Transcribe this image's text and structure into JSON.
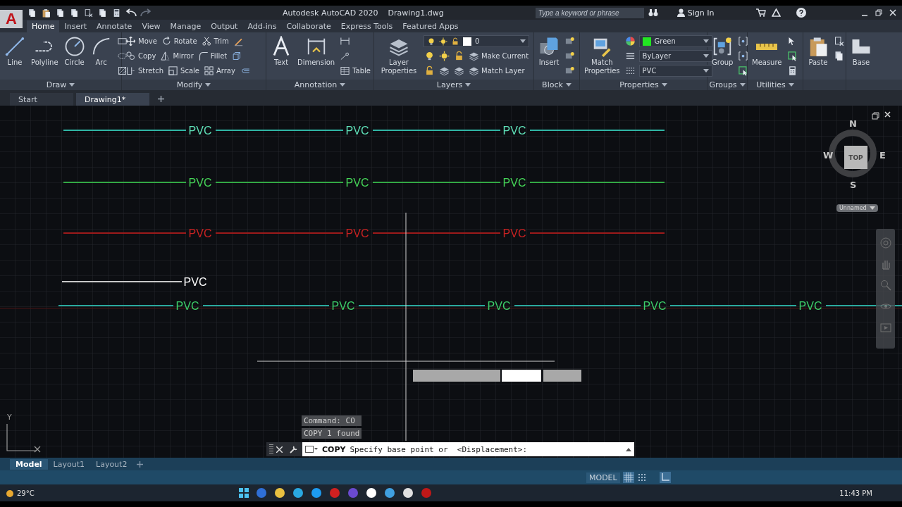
{
  "title_bar": {
    "app_button": "A",
    "title": "Autodesk AutoCAD 2020",
    "file": "Drawing1.dwg",
    "search": {
      "placeholder": "Type a keyword or phrase"
    },
    "sign_in": "Sign In"
  },
  "ribbon_tabs": [
    {
      "label": "Home",
      "selected": true
    },
    {
      "label": "Insert",
      "selected": false
    },
    {
      "label": "Annotate",
      "selected": false
    },
    {
      "label": "View",
      "selected": false
    },
    {
      "label": "Manage",
      "selected": false
    },
    {
      "label": "Output",
      "selected": false
    },
    {
      "label": "Add-ins",
      "selected": false
    },
    {
      "label": "Collaborate",
      "selected": false
    },
    {
      "label": "Express Tools",
      "selected": false
    },
    {
      "label": "Featured Apps",
      "selected": false
    }
  ],
  "ribbon_panels": [
    {
      "title": "Draw",
      "large": [
        "Line",
        "Polyline",
        "Circle",
        "Arc"
      ],
      "rows": [
        [
          {
            "kind": "icon"
          }
        ],
        [
          {
            "kind": "icon"
          }
        ],
        [
          {
            "kind": "icon"
          }
        ]
      ]
    },
    {
      "title": "Modify",
      "rows": [
        [
          {
            "kind": "tool",
            "label": "Move"
          },
          {
            "kind": "tool",
            "label": "Rotate"
          },
          {
            "kind": "tool",
            "label": "Trim"
          },
          {
            "kind": "icon"
          }
        ],
        [
          {
            "kind": "tool",
            "label": "Copy"
          },
          {
            "kind": "tool",
            "label": "Mirror"
          },
          {
            "kind": "tool",
            "label": "Fillet"
          },
          {
            "kind": "icon"
          }
        ],
        [
          {
            "kind": "tool",
            "label": "Stretch"
          },
          {
            "kind": "tool",
            "label": "Scale"
          },
          {
            "kind": "tool",
            "label": "Array"
          },
          {
            "kind": "icon"
          }
        ]
      ]
    },
    {
      "title": "Annotation",
      "large": [
        "Text",
        "Dimension"
      ],
      "rows": [
        [
          {
            "kind": "icon"
          }
        ],
        [
          {
            "kind": "icon"
          }
        ],
        [
          {
            "kind": "tool",
            "label": "Table"
          }
        ]
      ]
    },
    {
      "title": "Layers",
      "large": [
        "Layer Properties"
      ],
      "rows": [
        [
          {
            "kind": "dropdown",
            "label": "0"
          }
        ],
        [
          {
            "kind": "icon"
          },
          {
            "kind": "icon"
          },
          {
            "kind": "icon"
          },
          {
            "kind": "tool",
            "label": "Make Current"
          }
        ],
        [
          {
            "kind": "icon"
          },
          {
            "kind": "icon"
          },
          {
            "kind": "icon"
          },
          {
            "kind": "tool",
            "label": "Match Layer"
          }
        ]
      ]
    },
    {
      "title": "Block",
      "large": [
        "Insert"
      ],
      "rows": [
        [
          {
            "kind": "icon"
          }
        ],
        [
          {
            "kind": "icon"
          }
        ],
        [
          {
            "kind": "icon"
          }
        ]
      ]
    },
    {
      "title": "Properties",
      "large": [
        "Match Properties"
      ],
      "rows": [
        [
          {
            "kind": "icon"
          },
          {
            "kind": "color-dropdown",
            "label": "Green",
            "color": "#22e622"
          }
        ],
        [
          {
            "kind": "icon"
          },
          {
            "kind": "dropdown",
            "label": "ByLayer"
          }
        ],
        [
          {
            "kind": "icon"
          },
          {
            "kind": "dropdown",
            "label": "PVC"
          }
        ]
      ]
    },
    {
      "title": "Groups",
      "large": [
        "Group"
      ],
      "rows": [
        [
          {
            "kind": "icon"
          }
        ],
        [
          {
            "kind": "icon"
          }
        ],
        [
          {
            "kind": "icon"
          }
        ]
      ]
    },
    {
      "title": "Utilities",
      "large": [
        "Measure"
      ],
      "rows": [
        [
          {
            "kind": "icon"
          }
        ],
        [
          {
            "kind": "icon"
          }
        ],
        [
          {
            "kind": "icon"
          }
        ]
      ]
    },
    {
      "large": [
        "Paste"
      ],
      "rows": [
        [
          {
            "kind": "icon"
          }
        ],
        [
          {
            "kind": "icon"
          }
        ]
      ]
    },
    {
      "large": [
        "Base"
      ]
    }
  ],
  "file_tabs": [
    {
      "label": "Start",
      "selected": false
    },
    {
      "label": "Drawing1*",
      "selected": true
    }
  ],
  "drawing": {
    "rows": [
      {
        "kind": "long",
        "color": "#2fb5a4",
        "labels": [
          {
            "text": "PVC",
            "color": "#5fe0b8"
          },
          {
            "text": "PVC",
            "color": "#5fe0b8"
          },
          {
            "text": "PVC",
            "color": "#5fe0b8"
          }
        ]
      },
      {
        "kind": "long",
        "color": "#33a844",
        "labels": [
          {
            "text": "PVC",
            "color": "#45d457"
          },
          {
            "text": "PVC",
            "color": "#45d457"
          },
          {
            "text": "PVC",
            "color": "#45d457"
          }
        ]
      },
      {
        "kind": "long",
        "color": "#9c1a1a",
        "labels": [
          {
            "text": "PVC",
            "color": "#c82222"
          },
          {
            "text": "PVC",
            "color": "#c82222"
          },
          {
            "text": "PVC",
            "color": "#c82222"
          }
        ]
      },
      {
        "kind": "short",
        "color": "#c8c8c8",
        "labels": [
          {
            "text": "PVC",
            "color": "#ffffff"
          }
        ]
      },
      {
        "kind": "full",
        "color": "#2aa89c",
        "labels": [
          {
            "text": "PVC",
            "color": "#3ccf6a"
          },
          {
            "text": "PVC",
            "color": "#3ccf6a"
          },
          {
            "text": "PVC",
            "color": "#3ccf6a"
          },
          {
            "text": "PVC",
            "color": "#3ccf6a"
          },
          {
            "text": "PVC",
            "color": "#3ccf6a"
          }
        ]
      }
    ]
  },
  "ucs": {
    "y": "Y"
  },
  "viewcube": {
    "north": "N",
    "west": "W",
    "face": "TOP",
    "east": "E",
    "south": "S",
    "view": "Unnamed"
  },
  "command_history": [
    "Command: CO",
    "COPY 1 found"
  ],
  "command_line": {
    "command": "COPY",
    "prompt": "Specify base point or  <Displacement>:"
  },
  "layout_tabs": [
    {
      "label": "Model",
      "selected": true
    },
    {
      "label": "Layout1",
      "selected": false
    },
    {
      "label": "Layout2",
      "selected": false
    }
  ],
  "status_bar": {
    "space": "MODEL"
  },
  "taskbar": {
    "weather": "29°C",
    "time": "11:43 PM"
  }
}
